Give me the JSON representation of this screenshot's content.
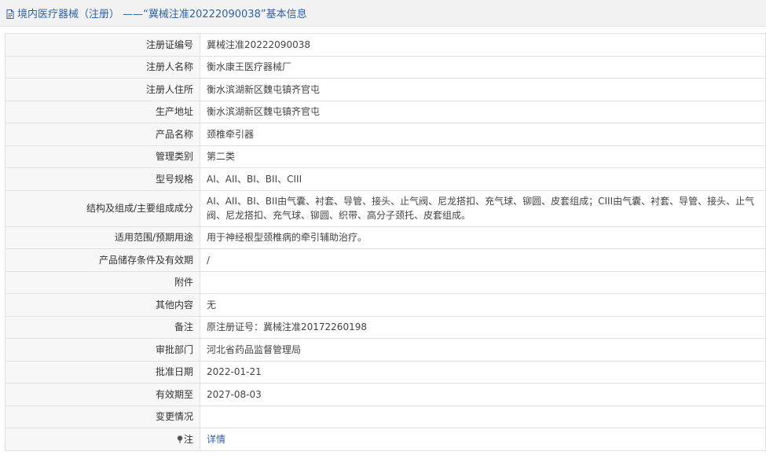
{
  "header": {
    "title": "境内医疗器械（注册） ——“冀械注准20222090038”基本信息"
  },
  "rows": [
    {
      "label": "注册证编号",
      "value": "冀械注准20222090038"
    },
    {
      "label": "注册人名称",
      "value": "衡水康王医疗器械厂"
    },
    {
      "label": "注册人住所",
      "value": "衡水滨湖新区魏屯镇齐官屯"
    },
    {
      "label": "生产地址",
      "value": "衡水滨湖新区魏屯镇齐官屯"
    },
    {
      "label": "产品名称",
      "value": "颈椎牵引器"
    },
    {
      "label": "管理类别",
      "value": "第二类"
    },
    {
      "label": "型号规格",
      "value": "AI、AII、BI、BII、CIII"
    },
    {
      "label": "结构及组成/主要组成成分",
      "value": "AI、AII、BI、BII由气囊、衬套、导管、接头、止气阀、尼龙搭扣、充气球、铆圆、皮套组成；CIII由气囊、衬套、导管、接头、止气阀、尼龙搭扣、充气球、铆圆、织带、高分子颈托、皮套组成。"
    },
    {
      "label": "适用范围/预期用途",
      "value": "用于神经根型颈椎病的牵引辅助治疗。"
    },
    {
      "label": "产品储存条件及有效期",
      "value": "/"
    },
    {
      "label": "附件",
      "value": ""
    },
    {
      "label": "其他内容",
      "value": "无"
    },
    {
      "label": "备注",
      "value": "原注册证号：冀械注准20172260198"
    },
    {
      "label": "审批部门",
      "value": "河北省药品监督管理局"
    },
    {
      "label": "批准日期",
      "value": "2022-01-21"
    },
    {
      "label": "有效期至",
      "value": "2027-08-03"
    },
    {
      "label": "变更情况",
      "value": ""
    },
    {
      "label": "注",
      "value": "详情"
    }
  ],
  "icons": {
    "header_icon": "document-icon",
    "note_icon": "pin-icon"
  },
  "colors": {
    "link": "#2f62a8",
    "label_bg": "#f7f7f7",
    "header_bg": "#f2f2f2",
    "border": "#e1e1e1"
  }
}
